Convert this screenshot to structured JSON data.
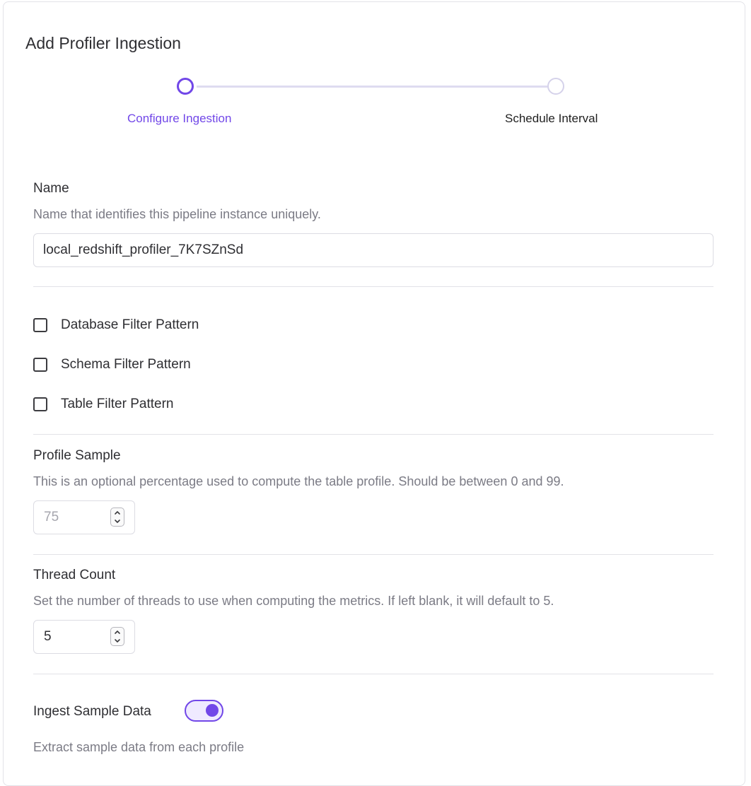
{
  "page": {
    "title": "Add Profiler Ingestion"
  },
  "stepper": {
    "steps": [
      {
        "label": "Configure Ingestion",
        "state": "active"
      },
      {
        "label": "Schedule Interval",
        "state": "inactive"
      }
    ]
  },
  "name_field": {
    "label": "Name",
    "description": "Name that identifies this pipeline instance uniquely.",
    "value": "local_redshift_profiler_7K7SZnSd"
  },
  "filters": [
    {
      "label": "Database Filter Pattern",
      "checked": false
    },
    {
      "label": "Schema Filter Pattern",
      "checked": false
    },
    {
      "label": "Table Filter Pattern",
      "checked": false
    }
  ],
  "profile_sample": {
    "label": "Profile Sample",
    "description": "This is an optional percentage used to compute the table profile. Should be between 0 and 99.",
    "placeholder": "75"
  },
  "thread_count": {
    "label": "Thread Count",
    "description": "Set the number of threads to use when computing the metrics. If left blank, it will default to 5.",
    "value": "5"
  },
  "ingest_sample": {
    "label": "Ingest Sample Data",
    "enabled": true,
    "description": "Extract sample data from each profile"
  },
  "colors": {
    "accent": "#7147e8",
    "step_inactive": "#d5d2ea",
    "muted_text": "#7b7b85"
  }
}
